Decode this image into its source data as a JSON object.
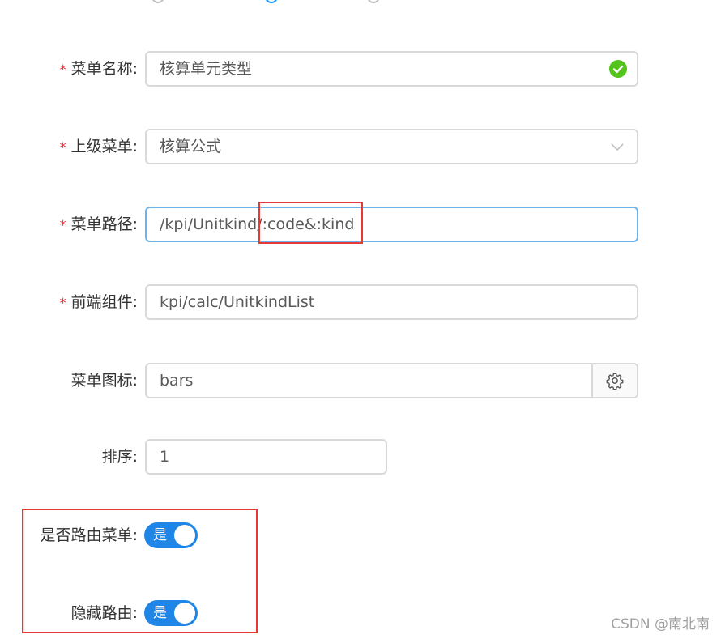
{
  "form": {
    "menu_name": {
      "label": "菜单名称:",
      "required": "*",
      "value": "核算单元类型"
    },
    "parent_menu": {
      "label": "上级菜单:",
      "required": "*",
      "value": "核算公式"
    },
    "menu_path": {
      "label": "菜单路径:",
      "required": "*",
      "value": "/kpi/Unitkind/:code&:kind"
    },
    "frontend_component": {
      "label": "前端组件:",
      "required": "*",
      "value": "kpi/calc/UnitkindList"
    },
    "menu_icon": {
      "label": "菜单图标:",
      "value": "bars",
      "addon_icon": "gear-icon"
    },
    "sort_order": {
      "label": "排序:",
      "value": "1"
    },
    "route_menu": {
      "label": "是否路由菜单:",
      "switch_text": "是",
      "checked": true
    },
    "hidden_route": {
      "label": "隐藏路由:",
      "switch_text": "是",
      "checked": true
    }
  },
  "colors": {
    "accent": "#1f86e8",
    "required": "#f5222d",
    "success": "#52c41a",
    "highlight": "#e53935",
    "focus_border": "#69b4ee"
  },
  "watermark": "CSDN @南北南"
}
